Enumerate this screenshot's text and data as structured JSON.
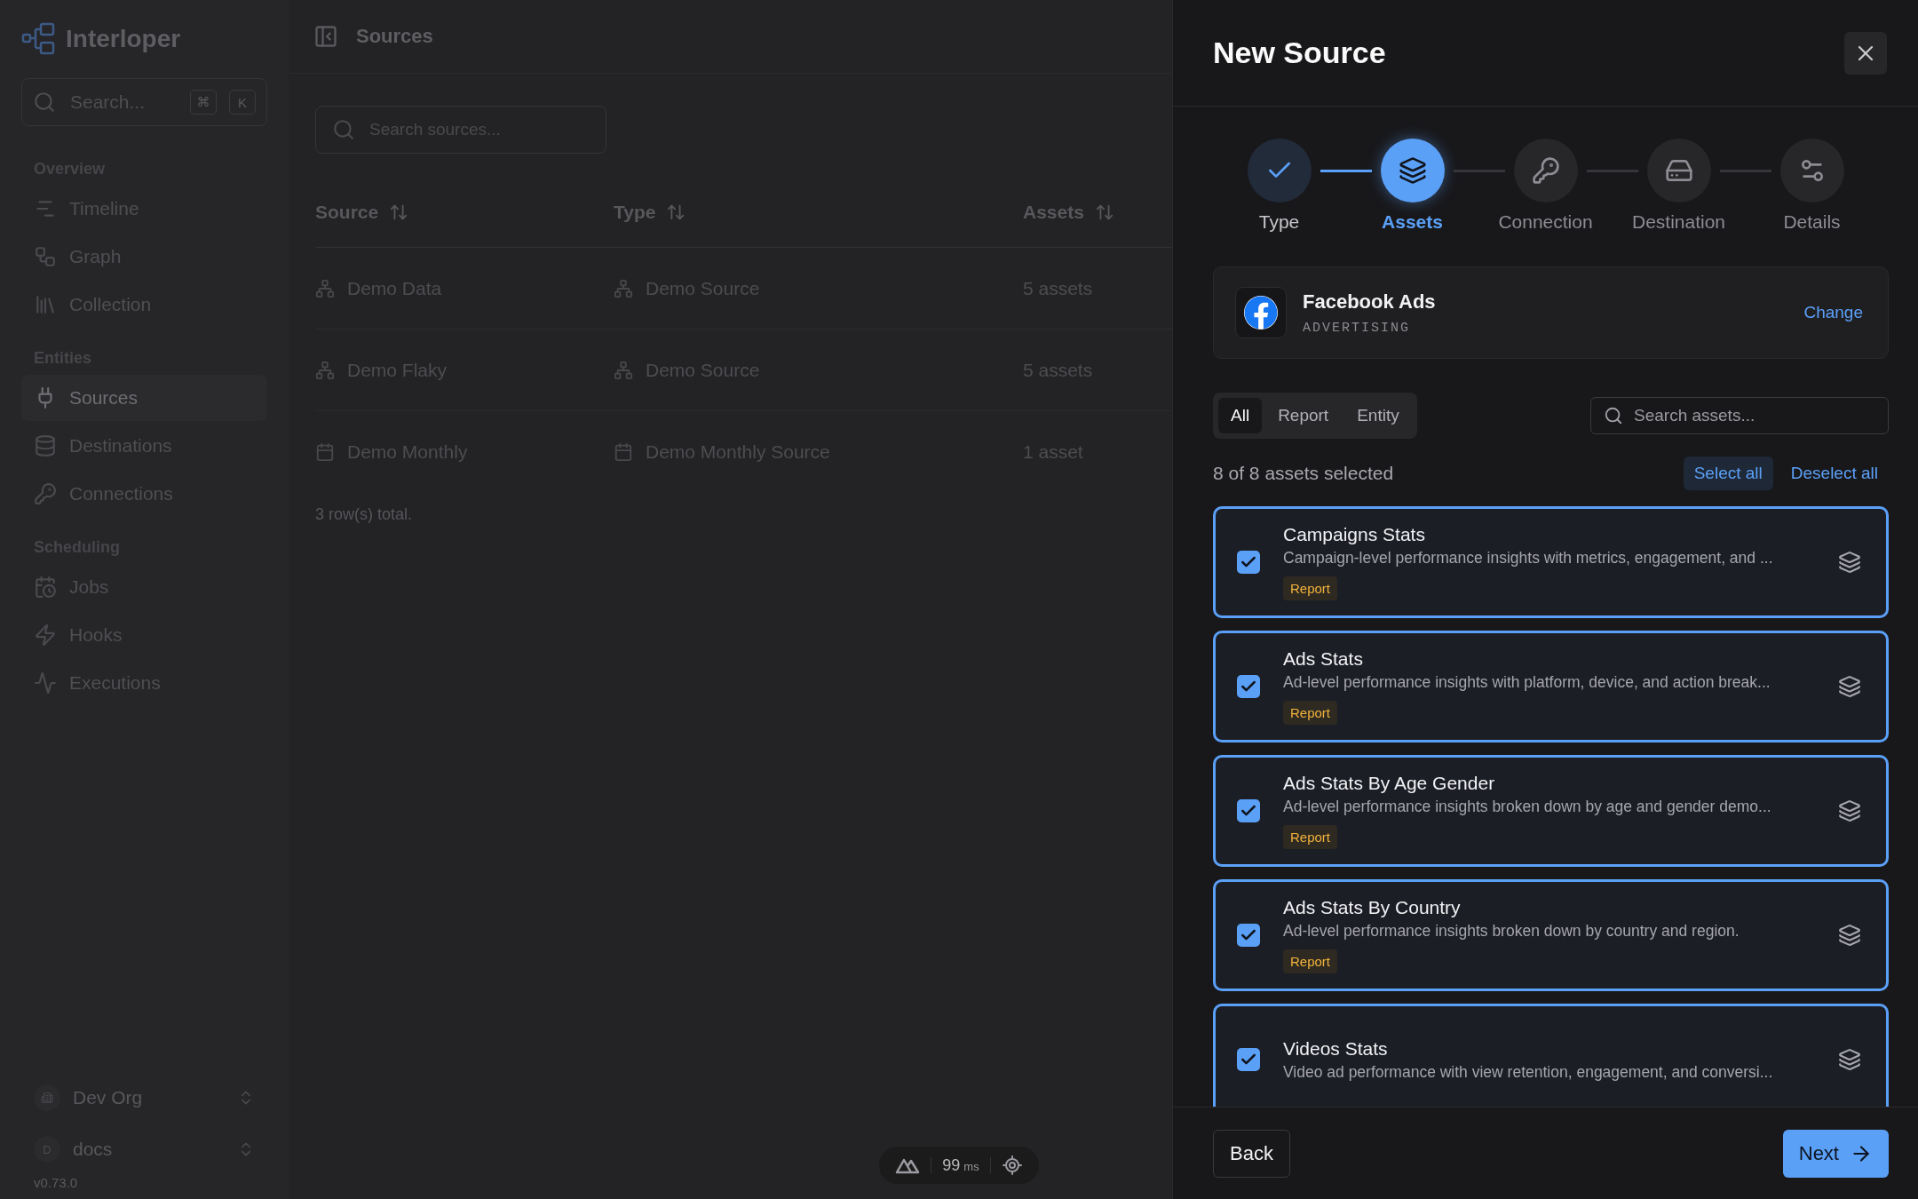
{
  "sidebar": {
    "brand": "Interloper",
    "search": {
      "placeholder": "Search...",
      "keys": [
        "⌘",
        "K"
      ]
    },
    "sections": [
      {
        "title": "Overview",
        "items": [
          {
            "label": "Timeline",
            "selected": false
          },
          {
            "label": "Graph",
            "selected": false
          },
          {
            "label": "Collection",
            "selected": false
          }
        ]
      },
      {
        "title": "Entities",
        "items": [
          {
            "label": "Sources",
            "selected": true
          },
          {
            "label": "Destinations",
            "selected": false
          },
          {
            "label": "Connections",
            "selected": false
          }
        ]
      },
      {
        "title": "Scheduling",
        "items": [
          {
            "label": "Jobs",
            "selected": false
          },
          {
            "label": "Hooks",
            "selected": false
          },
          {
            "label": "Executions",
            "selected": false
          }
        ]
      }
    ],
    "org": {
      "name": "Dev Org"
    },
    "workspace": {
      "initial": "D",
      "name": "docs"
    },
    "version": "v0.73.0"
  },
  "header": {
    "title": "Sources"
  },
  "table": {
    "search": {
      "placeholder": "Search sources..."
    },
    "columns": [
      "Source",
      "Type",
      "Assets"
    ],
    "rows": [
      {
        "kind": "server",
        "source": "Demo Data",
        "type": "Demo Source",
        "assets": "5 assets"
      },
      {
        "kind": "server",
        "source": "Demo Flaky",
        "type": "Demo Source",
        "assets": "5 assets"
      },
      {
        "kind": "calendar",
        "source": "Demo Monthly",
        "type": "Demo Monthly Source",
        "assets": "1 asset"
      }
    ],
    "footer": "3 row(s) total."
  },
  "perf": {
    "value": "99",
    "unit": "ms"
  },
  "drawer": {
    "title": "New Source",
    "steps": [
      {
        "label": "Type",
        "completed": true,
        "selected": false
      },
      {
        "label": "Assets",
        "completed": false,
        "selected": true
      },
      {
        "label": "Connection",
        "completed": false,
        "selected": false
      },
      {
        "label": "Destination",
        "completed": false,
        "selected": false
      },
      {
        "label": "Details",
        "completed": false,
        "selected": false
      }
    ],
    "source": {
      "name": "Facebook Ads",
      "category": "ADVERTISING",
      "action": "Change"
    },
    "filters": [
      {
        "label": "All",
        "selected": true
      },
      {
        "label": "Report",
        "selected": false
      },
      {
        "label": "Entity",
        "selected": false
      }
    ],
    "asset_search": {
      "placeholder": "Search assets..."
    },
    "count": "8 of 8 assets selected",
    "select_all": "Select all",
    "deselect_all": "Deselect all",
    "assets": [
      {
        "name": "Campaigns Stats",
        "description": "Campaign-level performance insights with metrics, engagement, and ...",
        "tag": "Report",
        "checked": true
      },
      {
        "name": "Ads Stats",
        "description": "Ad-level performance insights with platform, device, and action break...",
        "tag": "Report",
        "checked": true
      },
      {
        "name": "Ads Stats By Age Gender",
        "description": "Ad-level performance insights broken down by age and gender demo...",
        "tag": "Report",
        "checked": true
      },
      {
        "name": "Ads Stats By Country",
        "description": "Ad-level performance insights broken down by country and region.",
        "tag": "Report",
        "checked": true
      },
      {
        "name": "Videos Stats",
        "description": "Video ad performance with view retention, engagement, and conversi...",
        "checked": true
      }
    ],
    "back": "Back",
    "next": "Next"
  }
}
